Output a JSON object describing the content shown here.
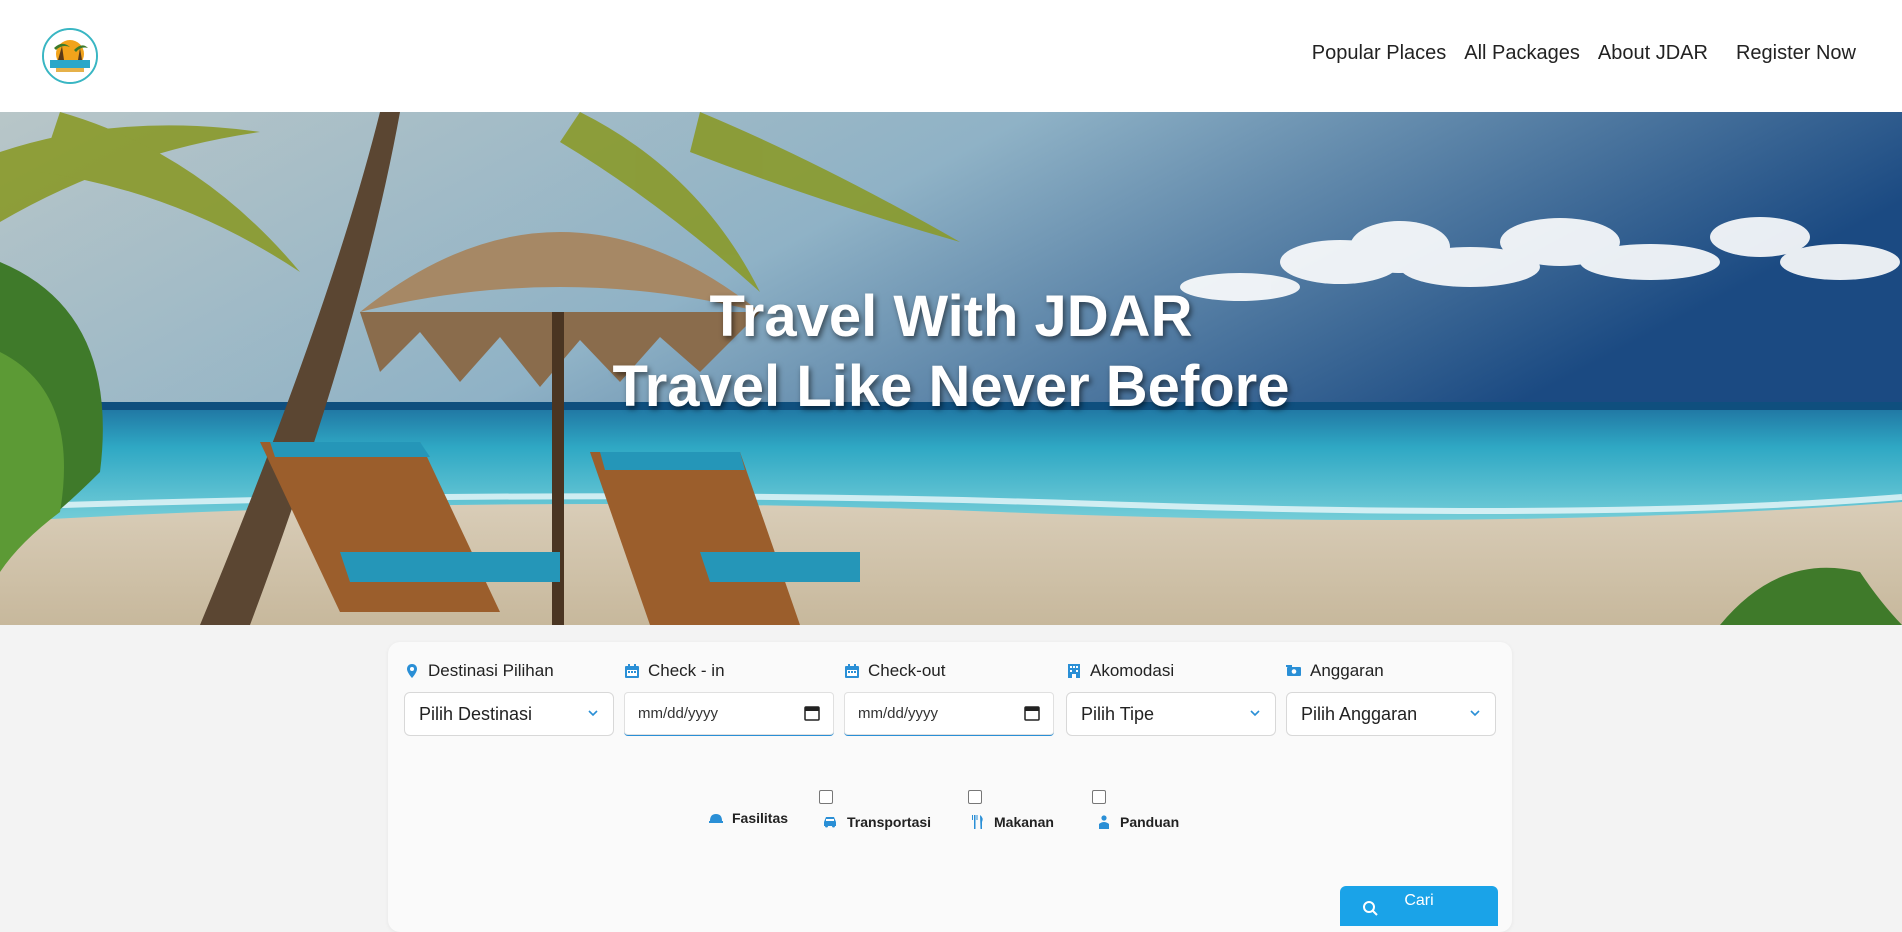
{
  "nav": {
    "logo_alt": "JDAR Travel logo",
    "links": [
      "Popular Places",
      "All Packages",
      "About JDAR"
    ],
    "register": "Register Now"
  },
  "hero": {
    "line1": "Travel With JDAR",
    "line2": "Travel Like Never Before"
  },
  "search": {
    "destination": {
      "label": "Destinasi Pilihan",
      "value": "Pilih Destinasi",
      "icon": "map-pin-icon"
    },
    "checkin": {
      "label": "Check - in",
      "value": "mm/dd/yyyy",
      "icon": "calendar-icon"
    },
    "checkout": {
      "label": "Check-out",
      "value": "mm/dd/yyyy",
      "icon": "calendar-icon"
    },
    "accommodation": {
      "label": "Akomodasi",
      "value": "Pilih Tipe",
      "icon": "hotel-icon"
    },
    "budget": {
      "label": "Anggaran",
      "value": "Pilih Anggaran",
      "icon": "money-icon"
    },
    "facilities": {
      "label": "Fasilitas",
      "options": [
        "Transportasi",
        "Makanan",
        "Panduan"
      ]
    },
    "submit": "Cari"
  },
  "colors": {
    "accent": "#1aa3e8",
    "icon": "#2a8fd6"
  }
}
